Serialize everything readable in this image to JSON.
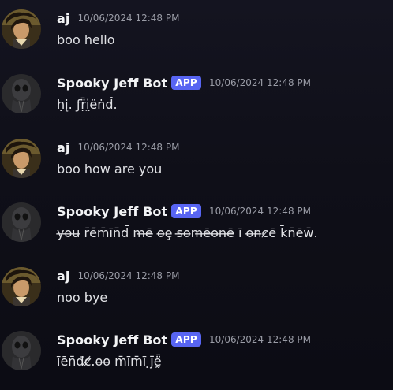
{
  "messages": [
    {
      "username": "aj",
      "avatar_icon": "aj-avatar-icon",
      "badge": "",
      "timestamp": "10/06/2024 12:48 PM",
      "text": "boo hello"
    },
    {
      "username": "Spooky Jeff Bot",
      "avatar_icon": "ghost-avatar-icon",
      "badge": "APP",
      "timestamp": "10/06/2024 12:48 PM",
      "text": "ḥ̣į. ƒṛ̈̄ḭ̇ëṅd̂."
    },
    {
      "username": "aj",
      "avatar_icon": "aj-avatar-icon",
      "badge": "",
      "timestamp": "10/06/2024 12:48 PM",
      "text": "boo how are you"
    },
    {
      "username": "Spooky Jeff Bot",
      "avatar_icon": "ghost-avatar-icon",
      "badge": "APP",
      "timestamp": "10/06/2024 12:48 PM",
      "text": "y̶o̶u̶ r̄ē̄m̄īn̄d̄ m̶ē̶ o̶ȩ s̶o̶m̶ē̶o̶n̶ē̶ ī o̶n̶ȼē k̄n̄ēw̄."
    },
    {
      "username": "aj",
      "avatar_icon": "aj-avatar-icon",
      "badge": "",
      "timestamp": "10/06/2024 12:48 PM",
      "text": "noo bye"
    },
    {
      "username": "Spooky Jeff Bot",
      "avatar_icon": "ghost-avatar-icon",
      "badge": "APP",
      "timestamp": "10/06/2024 12:48 PM",
      "text": "īēn̄đȼ̸.o̶o̶ m̄īm̄ī ̣j̄ḛ̈̄"
    }
  ],
  "colors": {
    "badge": "#5865f2",
    "username": "#f2f3f5",
    "timestamp": "#9a9ca6",
    "text": "#dfe0e4",
    "background": "#121220"
  }
}
